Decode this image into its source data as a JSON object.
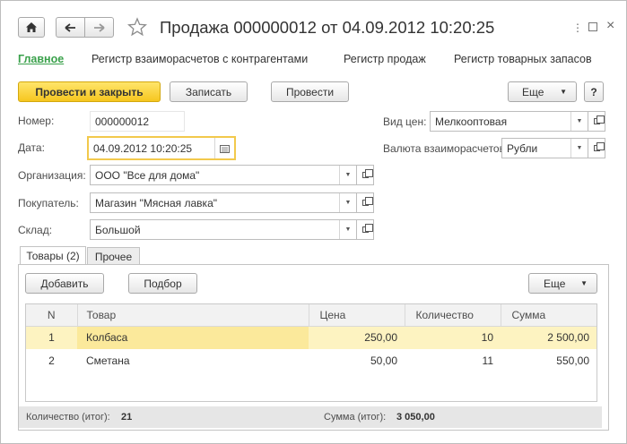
{
  "window": {
    "title": "Продажа 000000012 от 04.09.2012 10:20:25"
  },
  "nav": [
    "Главное",
    "Регистр взаиморасчетов с контрагентами",
    "Регистр продаж",
    "Регистр товарных запасов"
  ],
  "toolbar": {
    "post_close": "Провести и закрыть",
    "save": "Записать",
    "post": "Провести",
    "more": "Еще",
    "help": "?"
  },
  "form": {
    "number_label": "Номер:",
    "number_value": "000000012",
    "date_label": "Дата:",
    "date_value": "04.09.2012 10:20:25",
    "org_label": "Организация:",
    "org_value": "ООО \"Все для дома\"",
    "buyer_label": "Покупатель:",
    "buyer_value": "Магазин \"Мясная лавка\"",
    "warehouse_label": "Склад:",
    "warehouse_value": "Большой",
    "price_type_label": "Вид цен:",
    "price_type_value": "Мелкооптовая",
    "currency_label": "Валюта взаиморасчетов:",
    "currency_value": "Рубли"
  },
  "tabs": [
    "Товары (2)",
    "Прочее"
  ],
  "table_toolbar": {
    "add": "Добавить",
    "select": "Подбор",
    "more": "Еще"
  },
  "table": {
    "columns": [
      "N",
      "Товар",
      "Цена",
      "Количество",
      "Сумма"
    ],
    "rows": [
      [
        "1",
        "Колбаса",
        "250,00",
        "10",
        "2 500,00"
      ],
      [
        "2",
        "Сметана",
        "50,00",
        "11",
        "550,00"
      ]
    ]
  },
  "footer": {
    "qty_label": "Количество (итог):",
    "qty_value": "21",
    "sum_label": "Сумма (итог):",
    "sum_value": "3 050,00"
  },
  "colors": {
    "accent_green": "#3aa14b",
    "primary_yellow": "#f6c61f",
    "selected_row": "#fdf3c1",
    "selected_cell": "#fbe99b"
  }
}
